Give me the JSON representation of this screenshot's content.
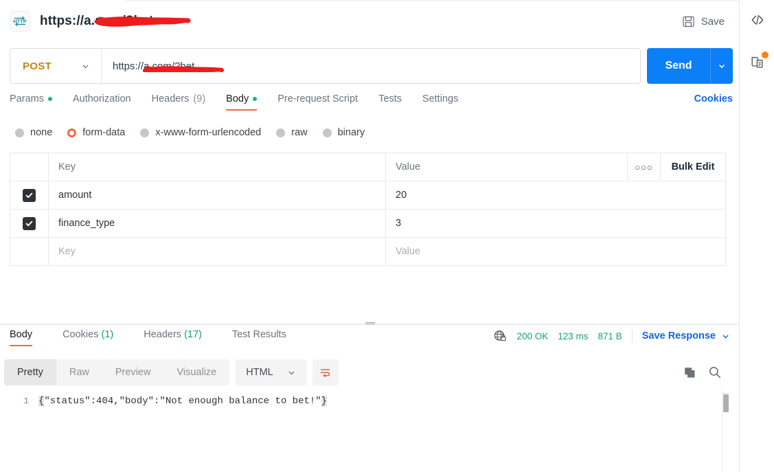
{
  "request": {
    "protocol_icon": "http-icon",
    "title": "https://a██████.com/?bet",
    "title_prefix": "https://a",
    "title_suffix": ".com/?bet",
    "save_label": "Save",
    "save_icon": "floppy-disk-save-icon",
    "method": "POST",
    "method_color": "#c78318",
    "url_prefix": "https://a",
    "url_suffix": ".com/?bet",
    "url_full": "https://a██████.com/?bet",
    "send_label": "Send",
    "send_color": "#0b7ff7",
    "tabs": [
      {
        "label": "Params",
        "dot": true,
        "count": null,
        "active": false
      },
      {
        "label": "Authorization",
        "dot": false,
        "count": null,
        "active": false
      },
      {
        "label": "Headers",
        "dot": false,
        "count": "(9)",
        "active": false
      },
      {
        "label": "Body",
        "dot": true,
        "count": null,
        "active": true
      },
      {
        "label": "Pre-request Script",
        "dot": false,
        "count": null,
        "active": false
      },
      {
        "label": "Tests",
        "dot": false,
        "count": null,
        "active": false
      },
      {
        "label": "Settings",
        "dot": false,
        "count": null,
        "active": false
      }
    ],
    "cookies_link": "Cookies",
    "body_modes": [
      {
        "label": "none",
        "selected": false
      },
      {
        "label": "form-data",
        "selected": true
      },
      {
        "label": "x-www-form-urlencoded",
        "selected": false
      },
      {
        "label": "raw",
        "selected": false
      },
      {
        "label": "binary",
        "selected": false
      }
    ],
    "table": {
      "header_key": "Key",
      "header_value": "Value",
      "ellipsis": "○○○",
      "bulk_edit": "Bulk Edit",
      "rows": [
        {
          "checked": true,
          "key": "amount",
          "value": "20"
        },
        {
          "checked": true,
          "key": "finance_type",
          "value": "3"
        }
      ],
      "placeholder_key": "Key",
      "placeholder_value": "Value"
    }
  },
  "response": {
    "tabs": [
      {
        "label": "Body",
        "count": null,
        "active": true
      },
      {
        "label": "Cookies",
        "count": "(1)",
        "active": false
      },
      {
        "label": "Headers",
        "count": "(17)",
        "active": false
      },
      {
        "label": "Test Results",
        "count": null,
        "active": false
      }
    ],
    "network_icon": "globe-lock-icon",
    "status": "200 OK",
    "time": "123 ms",
    "size": "871 B",
    "status_color": "#13a46c",
    "save_response_label": "Save Response",
    "view_modes": [
      {
        "label": "Pretty",
        "active": true
      },
      {
        "label": "Raw",
        "active": false
      },
      {
        "label": "Preview",
        "active": false
      },
      {
        "label": "Visualize",
        "active": false
      }
    ],
    "language": "HTML",
    "wrap_icon": "word-wrap-icon",
    "copy_icon": "copy-icon",
    "search_icon": "search-icon",
    "line_number": "1",
    "body_open_brace": "{",
    "body_text": "\"status\":404,\"body\":\"Not enough balance to bet!\"",
    "body_close_brace": "}"
  },
  "rail": {
    "items": [
      {
        "icon": "code-snippet-icon",
        "badge": false
      },
      {
        "icon": "documentation-icon",
        "badge": true
      }
    ],
    "badge_color": "#ff8210"
  },
  "redaction": {
    "color": "#ee1c1c"
  }
}
